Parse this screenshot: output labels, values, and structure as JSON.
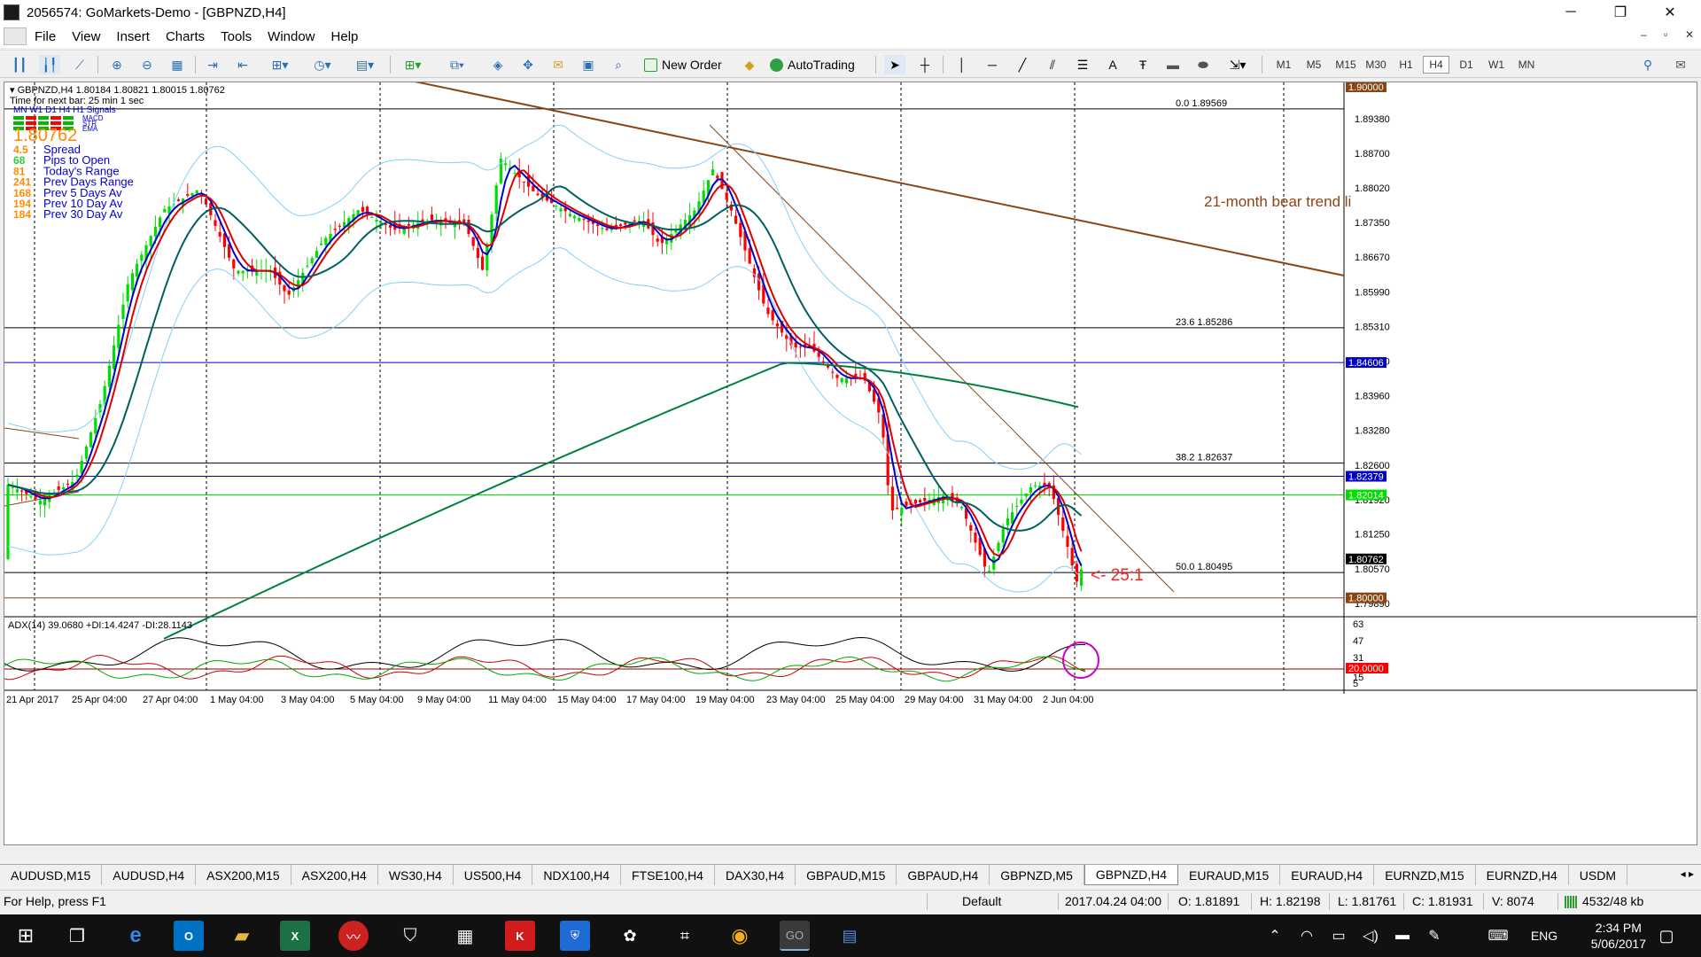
{
  "window": {
    "title": "2056574: GoMarkets-Demo - [GBPNZD,H4]",
    "minimize": "─",
    "restore": "❐",
    "close": "✕"
  },
  "menu": [
    "File",
    "View",
    "Insert",
    "Charts",
    "Tools",
    "Window",
    "Help"
  ],
  "mdi_controls": {
    "minimize": "–",
    "restore": "▫",
    "close": "✕"
  },
  "toolbar": {
    "new_order": "New Order",
    "autotrading": "AutoTrading",
    "timeframes": [
      "M1",
      "M5",
      "M15",
      "M30",
      "H1",
      "H4",
      "D1",
      "W1",
      "MN"
    ],
    "active_timeframe": "H4"
  },
  "chart": {
    "header": "GBPNZD,H4  1.80184 1.80821 1.80015 1.80762",
    "next_bar": "Time for next bar: 25 min 1 sec",
    "signals_label": "MN W1 D1 H4 H1 Signals",
    "signal_rows": [
      "MACD",
      "STR",
      "EMA"
    ],
    "big_price": "1.80762",
    "info_rows": [
      {
        "value": "4.5",
        "label": "Spread",
        "color": "#ff8c00"
      },
      {
        "value": "68",
        "label": "Pips to Open",
        "color": "#2ecc40"
      },
      {
        "value": "81",
        "label": "Today's Range",
        "color": "#ff8c00"
      },
      {
        "value": "241",
        "label": "Prev Days Range",
        "color": "#ff8c00"
      },
      {
        "value": "168",
        "label": "Prev 5 Days Av",
        "color": "#ff8c00"
      },
      {
        "value": "194",
        "label": "Prev 10 Day Av",
        "color": "#ff8c00"
      },
      {
        "value": "184",
        "label": "Prev 30 Day Av",
        "color": "#ff8c00"
      }
    ],
    "price_scale": [
      "1.89380",
      "1.88700",
      "1.88020",
      "1.87350",
      "1.86670",
      "1.85990",
      "1.85310",
      "1.84630",
      "1.83960",
      "1.83280",
      "1.82600",
      "1.81920",
      "1.81250",
      "1.80570",
      "1.79890"
    ],
    "price_tags": [
      {
        "label": "1.90000",
        "bg": "#8b4513",
        "fg": "#ffffff"
      },
      {
        "label": "1.84606",
        "bg": "#0000cc",
        "fg": "#ffffff"
      },
      {
        "label": "1.82379",
        "bg": "#0000cc",
        "fg": "#ffffff"
      },
      {
        "label": "1.82014",
        "bg": "#00dd00",
        "fg": "#ffffff"
      },
      {
        "label": "1.80762",
        "bg": "#000000",
        "fg": "#ffffff"
      },
      {
        "label": "1.80000",
        "bg": "#8b4513",
        "fg": "#ffffff"
      }
    ],
    "fib_labels": [
      "0.0  1.89569",
      "23.6  1.85286",
      "38.2  1.82637",
      "50.0  1.80495"
    ],
    "trend_label": "21-month bear trend li",
    "rr_label": "<- 25:1",
    "date_labels": [
      "21 Apr 2017",
      "25 Apr 04:00",
      "27 Apr 04:00",
      "1 May 04:00",
      "3 May 04:00",
      "5 May 04:00",
      "9 May 04:00",
      "11 May 04:00",
      "15 May 04:00",
      "17 May 04:00",
      "19 May 04:00",
      "23 May 04:00",
      "25 May 04:00",
      "29 May 04:00",
      "31 May 04:00",
      "2 Jun 04:00"
    ],
    "adx_header": "ADX(14) 39.0680 +DI:14.4247 -DI:28.1143",
    "adx_scale": [
      "63",
      "47",
      "31",
      "20.0000",
      "15",
      "5"
    ],
    "colors": {
      "bull": "#00dd00",
      "bear": "#ff0000",
      "ema_fast": "#0000cc",
      "ema_mid": "#dd0000",
      "ema_slow": "#006060",
      "sma_long": "#008040",
      "bb": "#87cefa",
      "trendline": "#8b4513"
    }
  },
  "tabs": [
    "AUDUSD,M15",
    "AUDUSD,H4",
    "ASX200,M15",
    "ASX200,H4",
    "WS30,H4",
    "US500,H4",
    "NDX100,H4",
    "FTSE100,H4",
    "DAX30,H4",
    "GBPAUD,M15",
    "GBPAUD,H4",
    "GBPNZD,M5",
    "GBPNZD,H4",
    "EURAUD,M15",
    "EURAUD,H4",
    "EURNZD,M15",
    "EURNZD,H4",
    "USDM"
  ],
  "active_tab": "GBPNZD,H4",
  "status": {
    "help": "For Help, press F1",
    "profile": "Default",
    "datetime": "2017.04.24 04:00",
    "open": "O: 1.81891",
    "high": "H: 1.82198",
    "low": "L: 1.81761",
    "close": "C: 1.81931",
    "volume": "V: 8074",
    "traffic": "4532/48 kb"
  },
  "taskbar": {
    "lang": "ENG",
    "time": "2:34 PM",
    "date": "5/06/2017"
  }
}
